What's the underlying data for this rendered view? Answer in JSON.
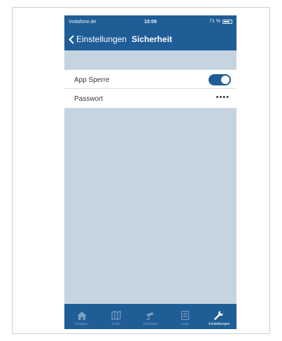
{
  "status_bar": {
    "carrier": "Vodafone.de",
    "time": "15:08",
    "battery": "71 %"
  },
  "nav": {
    "back_label": "Einstellungen",
    "title": "Sicherheit"
  },
  "settings": {
    "app_lock": {
      "label": "App Sperre",
      "enabled": true
    },
    "password": {
      "label": "Passwort",
      "masked_value": "••••"
    }
  },
  "tabs": [
    {
      "label": "Anlagen",
      "icon": "home-icon",
      "active": false
    },
    {
      "label": "Karte",
      "icon": "map-icon",
      "active": false
    },
    {
      "label": "Kameras",
      "icon": "camera-icon",
      "active": false
    },
    {
      "label": "Logs",
      "icon": "log-icon",
      "active": false
    },
    {
      "label": "Einstellungen",
      "icon": "wrench-icon",
      "active": true
    }
  ],
  "colors": {
    "primary": "#1f5d97",
    "background": "#c6d4e1",
    "inactive_tab": "#7f9fbf"
  }
}
